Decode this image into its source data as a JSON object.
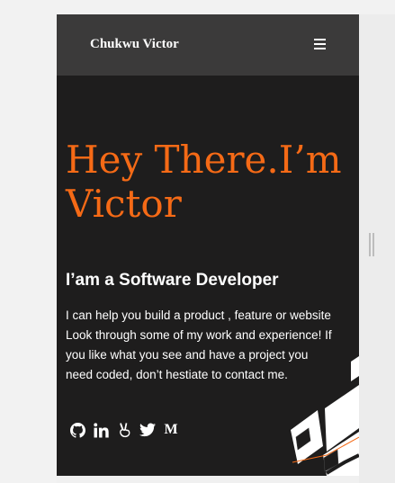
{
  "navbar": {
    "brand": "Chukwu Victor",
    "menu_icon": "hamburger-menu-icon"
  },
  "hero": {
    "title_line1": "Hey There.I’m",
    "title_line2": "Victor",
    "subtitle": "I’am a Software Developer",
    "description": "I can help you build a product , feature or website Look through some of my work and experience! If you like what you see and have a project you need coded, don’t hestiate to contact me."
  },
  "socials": [
    {
      "icon": "github-icon"
    },
    {
      "icon": "linkedin-icon"
    },
    {
      "icon": "peace-hand-icon"
    },
    {
      "icon": "twitter-icon"
    },
    {
      "icon": "medium-icon",
      "label": "M"
    }
  ],
  "colors": {
    "accent": "#f56a16",
    "background": "#1e1d1d",
    "navbar": "#3b3a3a",
    "text": "#ffffff"
  }
}
